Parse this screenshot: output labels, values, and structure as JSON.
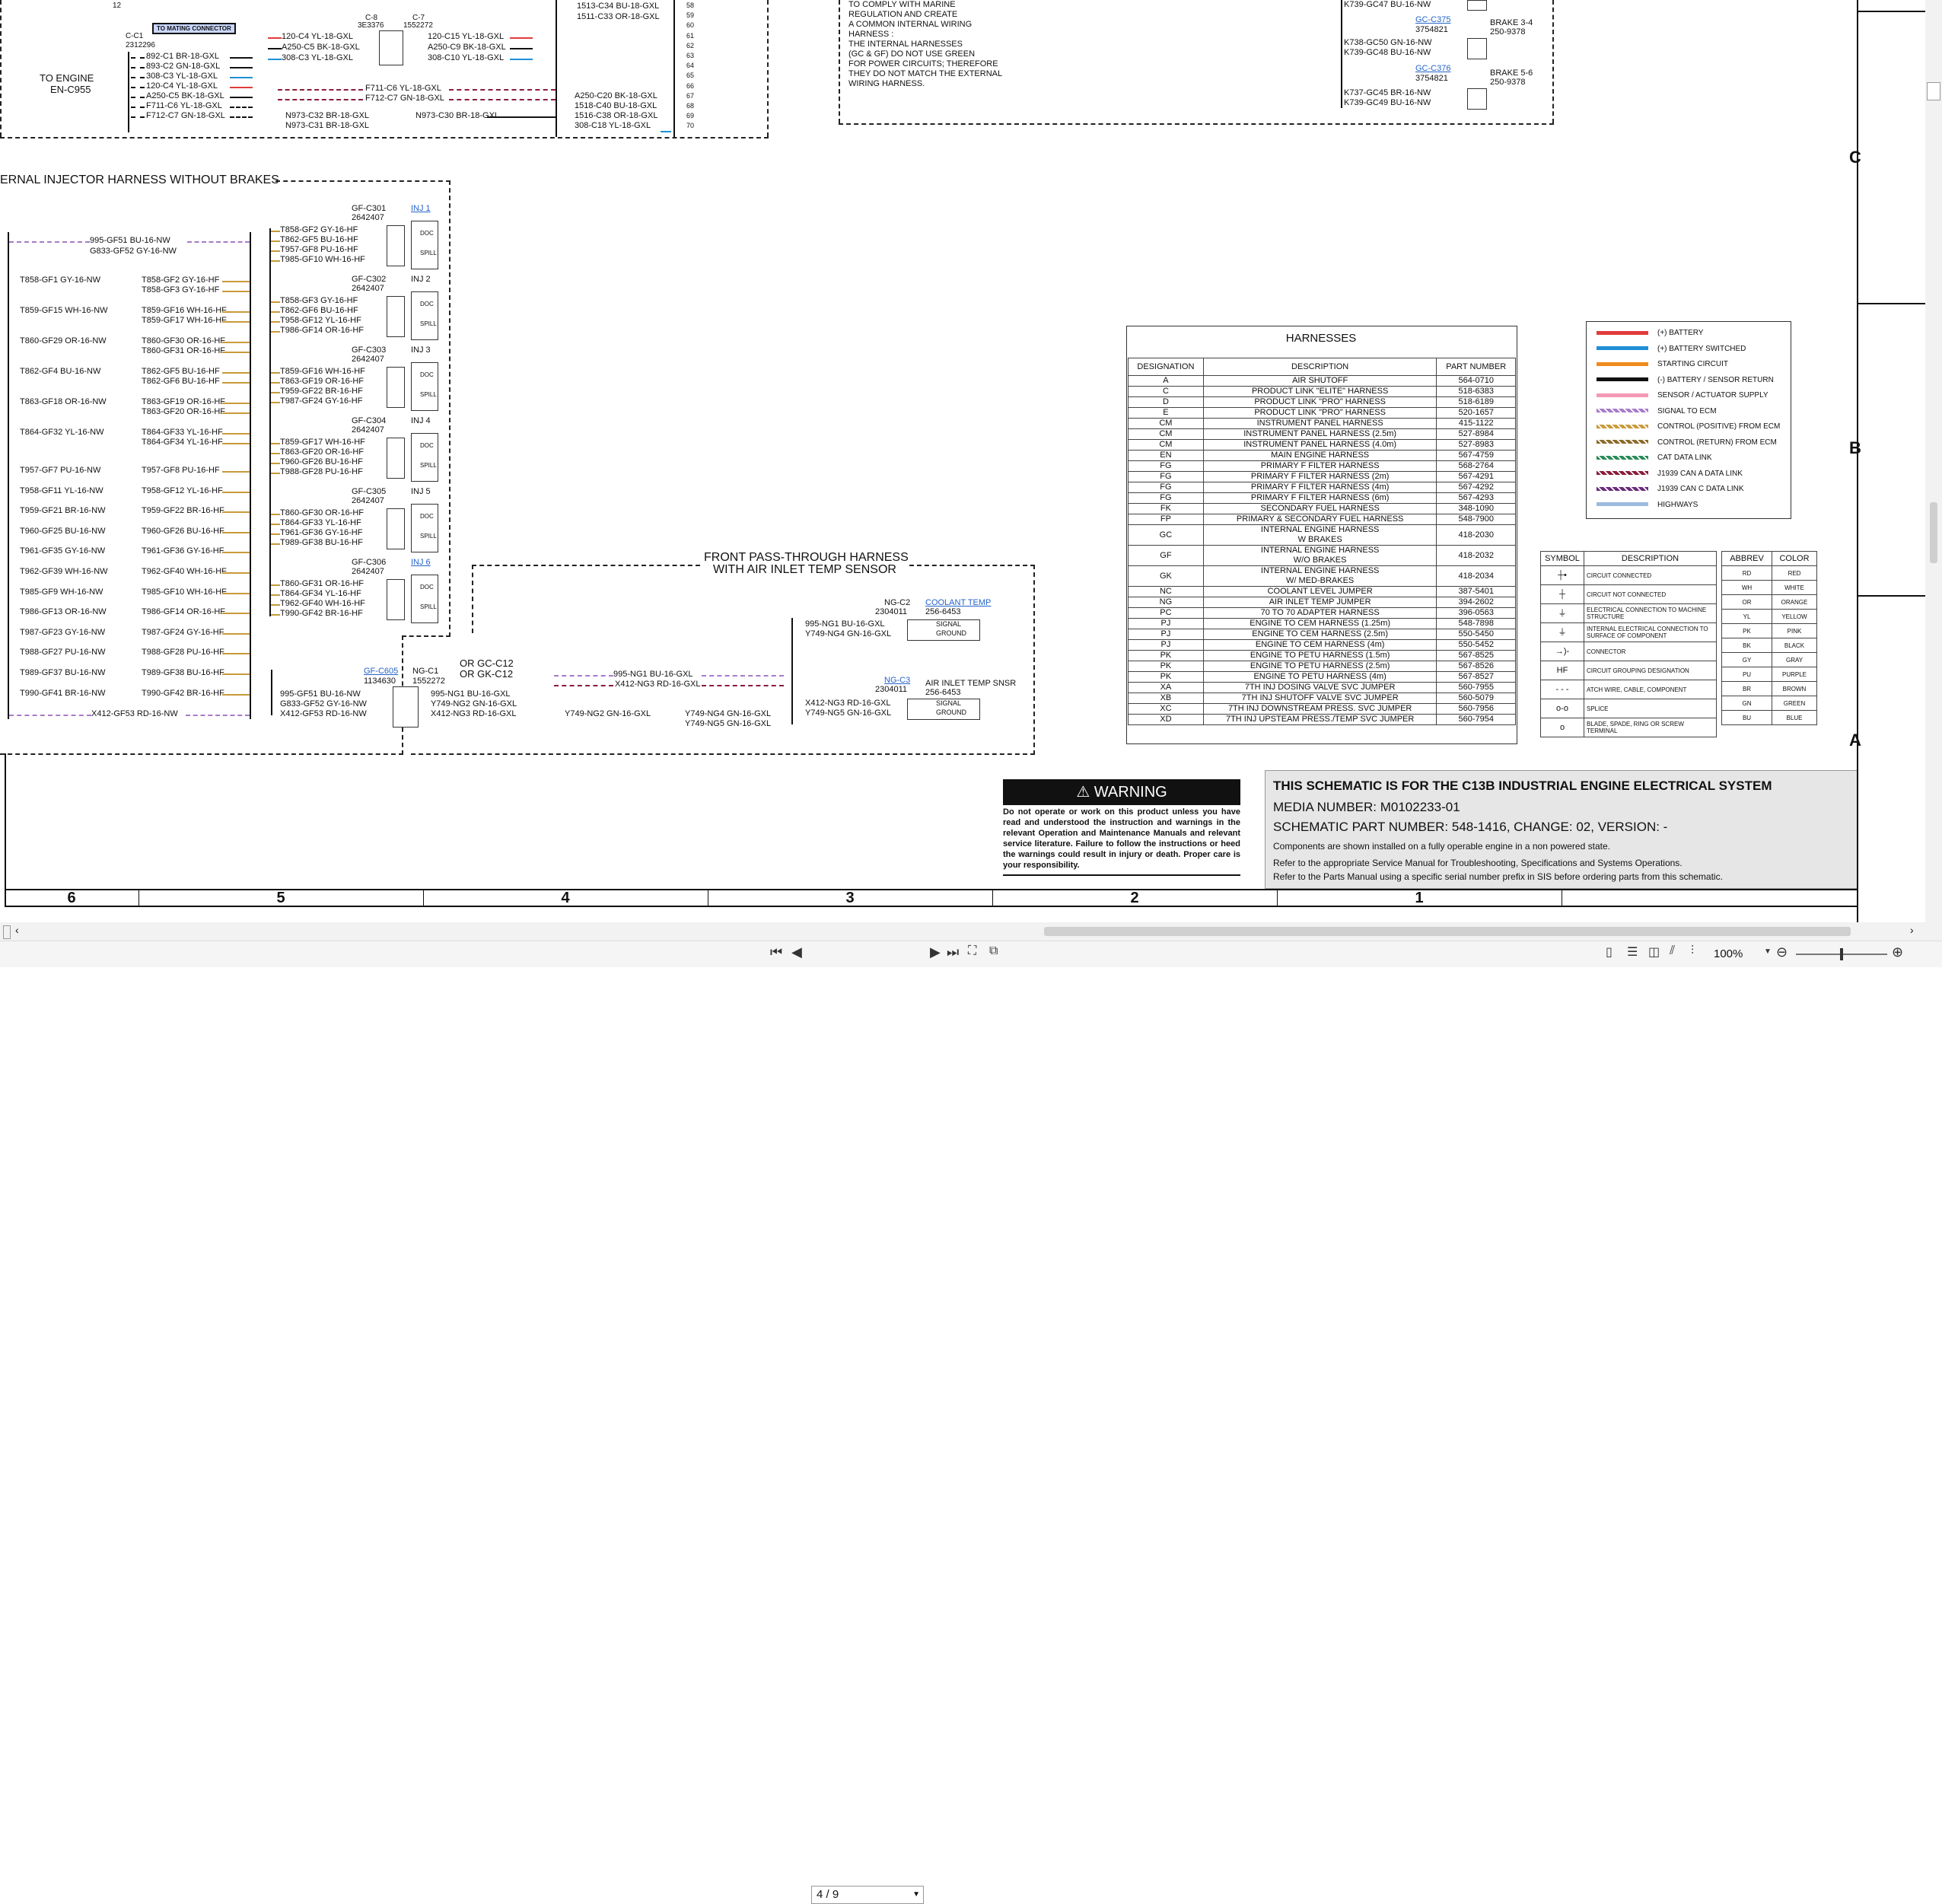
{
  "top": {
    "c_label": "C-C1",
    "c_part": "2312296",
    "mating": "TO MATING CONNECTOR",
    "to_engine_1": "TO ENGINE",
    "to_engine_2": "EN-C955",
    "left_wires": [
      "892-C1 BR-18-GXL",
      "893-C2 GN-18-GXL",
      "308-C3 YL-18-GXL",
      "120-C4 YL-18-GXL",
      "A250-C5 BK-18-GXL",
      "F711-C6 YL-18-GXL",
      "F712-C7 GN-18-GXL"
    ],
    "pin_12": "12",
    "c8_label": "C-8",
    "c8_part": "3E3376",
    "c7_label": "C-7",
    "c7_part": "1552272",
    "mid_left_wires": [
      "120-C4 YL-18-GXL",
      "A250-C5 BK-18-GXL",
      "308-C3 YL-18-GXL"
    ],
    "mid_right_wires": [
      "120-C15 YL-18-GXL",
      "A250-C9 BK-18-GXL",
      "308-C10 YL-18-GXL"
    ],
    "mid_wires_2": [
      "F711-C6 YL-18-GXL",
      "F712-C7 GN-18-GXL"
    ],
    "n973": [
      "N973-C32 BR-18-GXL",
      "N973-C31 BR-18-GXL",
      "N973-C30 BR-18-GXL"
    ],
    "right_block_top": [
      "1513-C34 BU-18-GXL",
      "1511-C33 OR-18-GXL"
    ],
    "right_block_bottom": [
      "A250-C20 BK-18-GXL",
      "1518-C40 BU-18-GXL",
      "1516-C38 OR-18-GXL",
      "308-C18 YL-18-GXL"
    ],
    "pin_numbers": [
      "58",
      "59",
      "60",
      "61",
      "62",
      "63",
      "64",
      "65",
      "66",
      "67",
      "68",
      "69",
      "70"
    ],
    "note_lines": [
      "TO COMPLY WITH MARINE",
      "REGULATION AND CREATE",
      "A COMMON INTERNAL WIRING",
      "HARNESS :",
      "THE INTERNAL HARNESSES",
      "(GC & GF) DO NOT USE GREEN",
      "FOR POWER CIRCUITS; THEREFORE",
      "THEY DO NOT MATCH THE EXTERNAL",
      "WIRING HARNESS."
    ],
    "brake_wires": [
      "K739-GC47 BU-16-NW",
      "K738-GC50 GN-16-NW",
      "K739-GC48 BU-16-NW",
      "K737-GC45 BR-16-NW",
      "K739-GC49 BU-16-NW"
    ],
    "gc_c375": "GC-C375",
    "gc_c376": "GC-C376",
    "part_3754821": "3754821",
    "brake_34": "BRAKE 3-4",
    "brake_56": "BRAKE 5-6",
    "part_250": "250-9378"
  },
  "injector": {
    "title": "ERNAL  INJECTOR HARNESS WITHOUT BRAKES",
    "left_wires": [
      "995-GF51 BU-16-NW",
      "G833-GF52 GY-16-NW"
    ],
    "left_rows": [
      {
        "a": "T858-GF1 GY-16-NW",
        "b": "T858-GF2 GY-16-HF",
        "c": "T858-GF3 GY-16-HF"
      },
      {
        "a": "T859-GF15 WH-16-NW",
        "b": "T859-GF16 WH-16-HF",
        "c": "T859-GF17 WH-16-HF"
      },
      {
        "a": "T860-GF29 OR-16-NW",
        "b": "T860-GF30 OR-16-HF",
        "c": "T860-GF31 OR-16-HF"
      },
      {
        "a": "T862-GF4 BU-16-NW",
        "b": "T862-GF5 BU-16-HF",
        "c": "T862-GF6 BU-16-HF"
      },
      {
        "a": "T863-GF18 OR-16-NW",
        "b": "T863-GF19 OR-16-HF",
        "c": "T863-GF20 OR-16-HF"
      },
      {
        "a": "T864-GF32 YL-16-NW",
        "b": "T864-GF33 YL-16-HF",
        "c": "T864-GF34 YL-16-HF"
      }
    ],
    "single_rows": [
      {
        "a": "T957-GF7 PU-16-NW",
        "b": "T957-GF8 PU-16-HF"
      },
      {
        "a": "T958-GF11 YL-16-NW",
        "b": "T958-GF12 YL-16-HF"
      },
      {
        "a": "T959-GF21 BR-16-NW",
        "b": "T959-GF22 BR-16-HF"
      },
      {
        "a": "T960-GF25 BU-16-NW",
        "b": "T960-GF26 BU-16-HF"
      },
      {
        "a": "T961-GF35 GY-16-NW",
        "b": "T961-GF36 GY-16-HF"
      },
      {
        "a": "T962-GF39 WH-16-NW",
        "b": "T962-GF40 WH-16-HF"
      },
      {
        "a": "T985-GF9 WH-16-NW",
        "b": "T985-GF10 WH-16-HF"
      },
      {
        "a": "T986-GF13 OR-16-NW",
        "b": "T986-GF14 OR-16-HF"
      },
      {
        "a": "T987-GF23 GY-16-NW",
        "b": "T987-GF24 GY-16-HF"
      },
      {
        "a": "T988-GF27 PU-16-NW",
        "b": "T988-GF28 PU-16-HF"
      },
      {
        "a": "T989-GF37 BU-16-NW",
        "b": "T989-GF38 BU-16-HF"
      },
      {
        "a": "T990-GF41 BR-16-NW",
        "b": "T990-GF42 BR-16-HF"
      }
    ],
    "x412": "X412-GF53 RD-16-NW",
    "injectors": [
      {
        "label": "GF-C301",
        "part": "2642407",
        "name": "INJ 1",
        "wires": [
          "T858-GF2 GY-16-HF",
          "T862-GF5 BU-16-HF",
          "T957-GF8 PU-16-HF",
          "T985-GF10 WH-16-HF"
        ]
      },
      {
        "label": "GF-C302",
        "part": "2642407",
        "name": "INJ 2",
        "wires": [
          "T858-GF3 GY-16-HF",
          "T862-GF6 BU-16-HF",
          "T958-GF12 YL-16-HF",
          "T986-GF14 OR-16-HF"
        ]
      },
      {
        "label": "GF-C303",
        "part": "2642407",
        "name": "INJ 3",
        "wires": [
          "T859-GF16 WH-16-HF",
          "T863-GF19 OR-16-HF",
          "T959-GF22 BR-16-HF",
          "T987-GF24 GY-16-HF"
        ]
      },
      {
        "label": "GF-C304",
        "part": "2642407",
        "name": "INJ 4",
        "wires": [
          "T859-GF17 WH-16-HF",
          "T863-GF20 OR-16-HF",
          "T960-GF26 BU-16-HF",
          "T988-GF28 PU-16-HF"
        ]
      },
      {
        "label": "GF-C305",
        "part": "2642407",
        "name": "INJ 5",
        "wires": [
          "T860-GF30 OR-16-HF",
          "T864-GF33 YL-16-HF",
          "T961-GF36 GY-16-HF",
          "T989-GF38 BU-16-HF"
        ]
      },
      {
        "label": "GF-C306",
        "part": "2642407",
        "name": "INJ 6",
        "wires": [
          "T860-GF31 OR-16-HF",
          "T864-GF34 YL-16-HF",
          "T962-GF40 WH-16-HF",
          "T990-GF42 BR-16-HF"
        ]
      }
    ],
    "doc": "DOC",
    "spill": "SPILL",
    "gf_c605": "GF-C605",
    "gf_c605_part": "1134630",
    "ng_c1": "NG-C1",
    "ng_c1_part": "1552272",
    "or_gc_1": "OR GC-C12",
    "or_gc_2": "OR GK-C12",
    "c605_wires": [
      "995-GF51 BU-16-NW",
      "G833-GF52 GY-16-NW",
      "X412-GF53 RD-16-NW"
    ],
    "ng_wires": [
      "995-NG1 BU-16-GXL",
      "Y749-NG2 GN-16-GXL",
      "X412-NG3 RD-16-GXL"
    ]
  },
  "front": {
    "title1": "FRONT PASS-THROUGH HARNESS",
    "title2": "WITH AIR INLET TEMP SENSOR",
    "w1": "995-NG1 BU-16-GXL",
    "w2": "X412-NG3 RD-16-GXL",
    "w3": "Y749-NG2 GN-16-GXL",
    "w4": "Y749-NG4 GN-16-GXL",
    "w5": "Y749-NG5 GN-16-GXL",
    "ng_c2": "NG-C2",
    "ng_c2_part": "2304011",
    "coolant": "COOLANT TEMP",
    "coolant_part": "256-6453",
    "c2_wires": [
      "995-NG1 BU-16-GXL",
      "Y749-NG4 GN-16-GXL"
    ],
    "ng_c3": "NG-C3",
    "ng_c3_part": "2304011",
    "air_inlet": "AIR INLET TEMP SNSR",
    "air_part": "256-6453",
    "c3_wires": [
      "X412-NG3 RD-16-GXL",
      "Y749-NG5 GN-16-GXL"
    ],
    "signal": "SIGNAL",
    "ground": "GROUND"
  },
  "harnesses": {
    "title": "HARNESSES",
    "headers": [
      "DESIGNATION",
      "DESCRIPTION",
      "PART NUMBER"
    ],
    "rows": [
      [
        "A",
        "AIR SHUTOFF",
        "564-0710"
      ],
      [
        "C",
        "PRODUCT LINK \"ELITE\" HARNESS",
        "518-6383"
      ],
      [
        "D",
        "PRODUCT LINK \"PRO\" HARNESS",
        "518-6189"
      ],
      [
        "E",
        "PRODUCT LINK \"PRO\" HARNESS",
        "520-1657"
      ],
      [
        "CM",
        "INSTRUMENT PANEL HARNESS",
        "415-1122"
      ],
      [
        "CM",
        "INSTRUMENT PANEL HARNESS (2.5m)",
        "527-8984"
      ],
      [
        "CM",
        "INSTRUMENT PANEL HARNESS (4.0m)",
        "527-8983"
      ],
      [
        "EN",
        "MAIN ENGINE HARNESS",
        "567-4759"
      ],
      [
        "FG",
        "PRIMARY F FILTER HARNESS",
        "568-2764"
      ],
      [
        "FG",
        "PRIMARY F FILTER HARNESS (2m)",
        "567-4291"
      ],
      [
        "FG",
        "PRIMARY F FILTER HARNESS (4m)",
        "567-4292"
      ],
      [
        "FG",
        "PRIMARY F FILTER HARNESS (6m)",
        "567-4293"
      ],
      [
        "FK",
        "SECONDARY FUEL HARNESS",
        "348-1090"
      ],
      [
        "FP",
        "PRIMARY & SECONDARY FUEL HARNESS",
        "548-7900"
      ],
      [
        "GC",
        "INTERNAL ENGINE HARNESS\nW BRAKES",
        "418-2030"
      ],
      [
        "GF",
        "INTERNAL ENGINE HARNESS\nW/O BRAKES",
        "418-2032"
      ],
      [
        "GK",
        "INTERNAL ENGINE HARNESS\nW/ MED-BRAKES",
        "418-2034"
      ],
      [
        "NC",
        "COOLANT LEVEL JUMPER",
        "387-5401"
      ],
      [
        "NG",
        "AIR INLET TEMP JUMPER",
        "394-2602"
      ],
      [
        "PC",
        "70 TO 70 ADAPTER HARNESS",
        "396-0563"
      ],
      [
        "PJ",
        "ENGINE TO CEM HARNESS (1.25m)",
        "548-7898"
      ],
      [
        "PJ",
        "ENGINE TO CEM HARNESS (2.5m)",
        "550-5450"
      ],
      [
        "PJ",
        "ENGINE TO CEM HARNESS (4m)",
        "550-5452"
      ],
      [
        "PK",
        "ENGINE TO PETU HARNESS (1.5m)",
        "567-8525"
      ],
      [
        "PK",
        "ENGINE TO PETU HARNESS (2.5m)",
        "567-8526"
      ],
      [
        "PK",
        "ENGINE TO PETU HARNESS (4m)",
        "567-8527"
      ],
      [
        "XA",
        "7TH INJ DOSING VALVE SVC JUMPER",
        "560-7955"
      ],
      [
        "XB",
        "7TH INJ SHUTOFF VALVE SVC JUMPER",
        "560-5079"
      ],
      [
        "XC",
        "7TH INJ DOWNSTREAM PRESS. SVC JUMPER",
        "560-7956"
      ],
      [
        "XD",
        "7TH INJ UPSTEAM PRESS./TEMP SVC JUMPER",
        "560-7954"
      ]
    ]
  },
  "wire_legend": [
    {
      "color": "#e23b3b",
      "label": "(+) BATTERY"
    },
    {
      "color": "#1e90d6",
      "label": "(+) BATTERY SWITCHED"
    },
    {
      "color": "#f08a1c",
      "label": "STARTING CIRCUIT"
    },
    {
      "color": "#111111",
      "label": "(-) BATTERY / SENSOR RETURN"
    },
    {
      "color": "#f49ab6",
      "label": "SENSOR / ACTUATOR SUPPLY"
    },
    {
      "color": "#a77bc9",
      "label": "SIGNAL TO ECM"
    },
    {
      "color": "#c89a3a",
      "label": "CONTROL (POSITIVE) FROM ECM"
    },
    {
      "color": "#8a6a2a",
      "label": "CONTROL (RETURN) FROM ECM"
    },
    {
      "color": "#2a8a5a",
      "label": "CAT DATA LINK"
    },
    {
      "color": "#8a1c3a",
      "label": "J1939 CAN A DATA LINK"
    },
    {
      "color": "#6a2a7a",
      "label": "J1939 CAN C DATA LINK"
    },
    {
      "color": "#9bbbe0",
      "label": "HIGHWAYS"
    }
  ],
  "symbols": {
    "headers": [
      "SYMBOL",
      "DESCRIPTION"
    ],
    "rows": [
      {
        "sym": "┼•",
        "desc": "CIRCUIT CONNECTED"
      },
      {
        "sym": "┼",
        "desc": "CIRCUIT NOT CONNECTED"
      },
      {
        "sym": "⏚",
        "desc": "ELECTRICAL CONNECTION TO MACHINE STRUCTURE"
      },
      {
        "sym": "⏚",
        "desc": "INTERNAL ELECTRICAL CONNECTION TO SURFACE OF COMPONENT"
      },
      {
        "sym": "→)-",
        "desc": "CONNECTOR"
      },
      {
        "sym": "HF",
        "desc": "CIRCUIT GROUPING DESIGNATION"
      },
      {
        "sym": "- - -",
        "desc": "ATCH WIRE, CABLE, COMPONENT"
      },
      {
        "sym": "o-o",
        "desc": "SPLICE"
      },
      {
        "sym": "o",
        "desc": "BLADE, SPADE, RING OR SCREW TERMINAL"
      }
    ]
  },
  "abbrev": {
    "headers": [
      "ABBREV",
      "COLOR"
    ],
    "rows": [
      [
        "RD",
        "RED"
      ],
      [
        "WH",
        "WHITE"
      ],
      [
        "OR",
        "ORANGE"
      ],
      [
        "YL",
        "YELLOW"
      ],
      [
        "PK",
        "PINK"
      ],
      [
        "BK",
        "BLACK"
      ],
      [
        "GY",
        "GRAY"
      ],
      [
        "PU",
        "PURPLE"
      ],
      [
        "BR",
        "BROWN"
      ],
      [
        "GN",
        "GREEN"
      ],
      [
        "BU",
        "BLUE"
      ]
    ]
  },
  "warning": {
    "title": "WARNING",
    "text": "Do not operate or work on this product unless you have read and understood the instruction and warnings in the relevant Operation and Maintenance Manuals and relevant service literature. Failure to follow the instructions or heed the warnings could result in injury or death. Proper care is your responsibility."
  },
  "notice": {
    "title": "THIS SCHEMATIC IS FOR THE C13B INDUSTRIAL ENGINE ELECTRICAL SYSTEM",
    "media": "MEDIA NUMBER: M0102233-01",
    "part": "SCHEMATIC PART NUMBER: 548-1416, CHANGE: 02, VERSION: -",
    "note1": "Components are shown installed on a fully operable engine in a non powered state.",
    "note2": "Refer to the appropriate Service Manual for Troubleshooting, Specifications and Systems Operations.",
    "note3": "Refer to the Parts Manual using a specific serial number prefix in SIS before ordering parts from this schematic."
  },
  "grid": {
    "columns": [
      "6",
      "5",
      "4",
      "3",
      "2",
      "1"
    ],
    "rows": [
      "C",
      "B",
      "A"
    ]
  },
  "viewer": {
    "page": "4 / 9",
    "zoom": "100%"
  }
}
